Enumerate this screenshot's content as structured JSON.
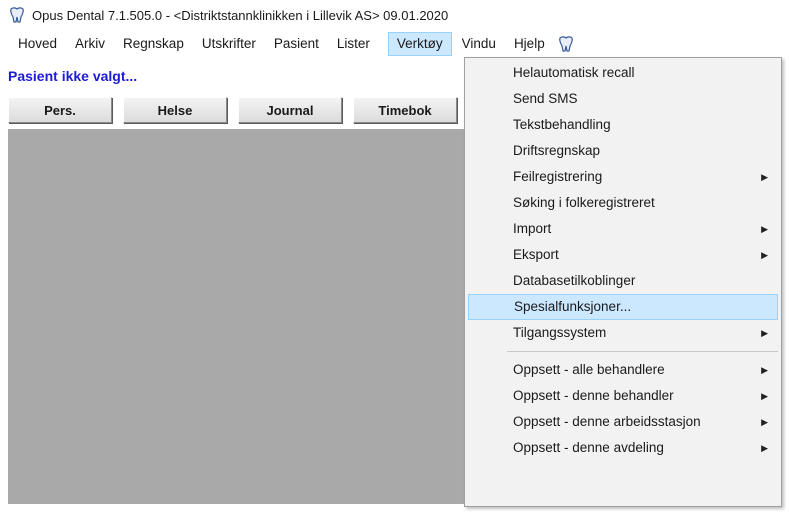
{
  "window": {
    "title": "Opus Dental 7.1.505.0 - <Distriktstannklinikken i Lillevik AS> 09.01.2020"
  },
  "menubar": {
    "items": [
      "Hoved",
      "Arkiv",
      "Regnskap",
      "Utskrifter",
      "Pasient",
      "Lister",
      "Verktøy",
      "Vindu",
      "Hjelp"
    ],
    "active": "Verktøy"
  },
  "patient_status": "Pasient ikke valgt...",
  "tabs": [
    "Pers.",
    "Helse",
    "Journal",
    "Timebok"
  ],
  "verktoy_menu": {
    "items": [
      {
        "label": "Helautomatisk recall",
        "submenu": false
      },
      {
        "label": "Send SMS",
        "submenu": false
      },
      {
        "label": "Tekstbehandling",
        "submenu": false
      },
      {
        "label": "Driftsregnskap",
        "submenu": false
      },
      {
        "label": "Feilregistrering",
        "submenu": true
      },
      {
        "label": "Søking i folkeregistreret",
        "submenu": false
      },
      {
        "label": "Import",
        "submenu": true
      },
      {
        "label": "Eksport",
        "submenu": true
      },
      {
        "label": "Databasetilkoblinger",
        "submenu": false
      },
      {
        "label": "Spesialfunksjoner...",
        "submenu": false,
        "highlighted": true
      },
      {
        "label": "Tilgangssystem",
        "submenu": true
      },
      {
        "label": "Oppsett - alle behandlere",
        "submenu": true
      },
      {
        "label": "Oppsett - denne behandler",
        "submenu": true
      },
      {
        "label": "Oppsett - denne arbeidsstasjon",
        "submenu": true
      },
      {
        "label": "Oppsett - denne avdeling",
        "submenu": true
      }
    ]
  },
  "icons": {
    "app_icon": "tooth-icon",
    "help_icon": "tooth-help-icon",
    "submenu_arrow": "triangle-right-icon"
  },
  "colors": {
    "patient_text": "#1c1cd6",
    "workspace": "#a9a9a9",
    "highlight": "#cce8ff"
  }
}
